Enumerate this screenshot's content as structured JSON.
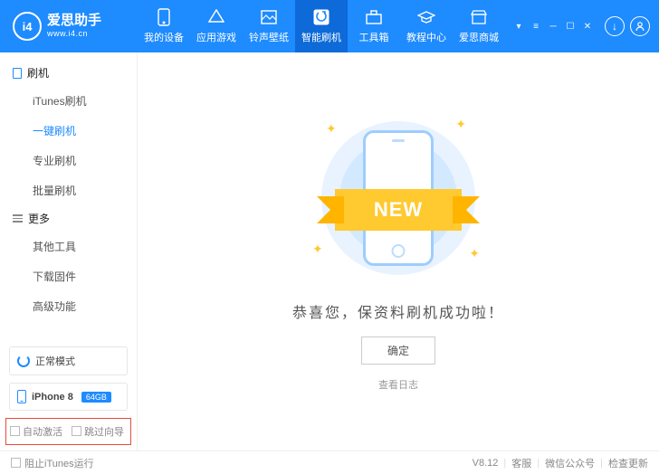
{
  "app": {
    "name": "爱思助手",
    "url": "www.i4.cn",
    "logo_letters": "i4"
  },
  "nav": {
    "items": [
      {
        "label": "我的设备"
      },
      {
        "label": "应用游戏"
      },
      {
        "label": "铃声壁纸"
      },
      {
        "label": "智能刷机"
      },
      {
        "label": "工具箱"
      },
      {
        "label": "教程中心"
      },
      {
        "label": "爱思商城"
      }
    ],
    "active_index": 3
  },
  "sidebar": {
    "group1_title": "刷机",
    "group1_items": [
      "iTunes刷机",
      "一键刷机",
      "专业刷机",
      "批量刷机"
    ],
    "group1_active_index": 1,
    "group2_title": "更多",
    "group2_items": [
      "其他工具",
      "下载固件",
      "高级功能"
    ],
    "mode_label": "正常模式",
    "device_name": "iPhone 8",
    "device_storage": "64GB",
    "check_auto_activate": "自动激活",
    "check_skip_wizard": "跳过向导"
  },
  "main": {
    "ribbon_text": "NEW",
    "success_msg": "恭喜您，保资料刷机成功啦！",
    "ok_btn": "确定",
    "view_log": "查看日志"
  },
  "footer": {
    "block_itunes": "阻止iTunes运行",
    "version": "V8.12",
    "support": "客服",
    "wechat": "微信公众号",
    "check_update": "检查更新"
  }
}
